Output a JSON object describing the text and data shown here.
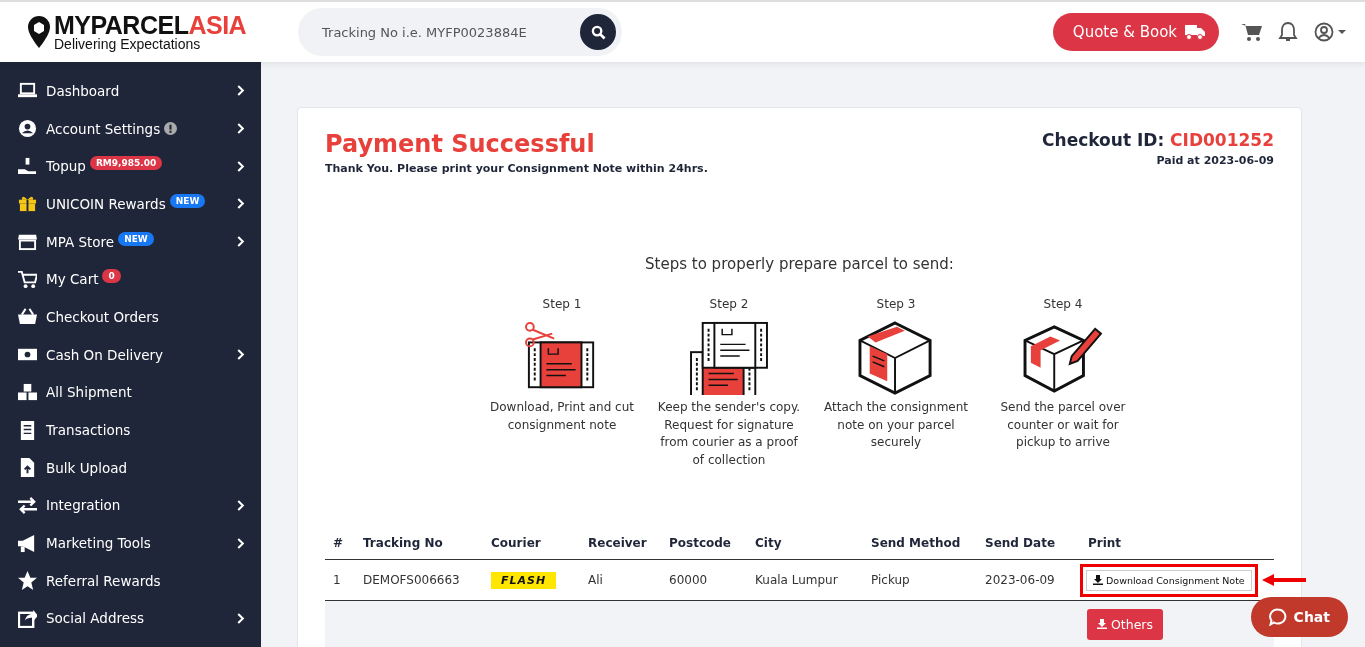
{
  "header": {
    "logo": {
      "main": "MYPARCEL",
      "accent": "ASIA",
      "tagline": "Delivering Expectations"
    },
    "search": {
      "placeholder": "Tracking No i.e. MYFP0023884E"
    },
    "quote_button": "Quote & Book"
  },
  "sidebar": {
    "items": [
      {
        "kind": "laptop",
        "label": "Dashboard",
        "has_submenu": true
      },
      {
        "kind": "user",
        "label": "Account Settings",
        "info": true,
        "has_submenu": true
      },
      {
        "kind": "topup",
        "label": "Topup",
        "badge": {
          "text": "RM9,985.00",
          "kind": "alert"
        },
        "has_submenu": true
      },
      {
        "kind": "gift",
        "label": "UNICOIN Rewards",
        "badge": {
          "text": "NEW",
          "kind": "new"
        },
        "has_submenu": true
      },
      {
        "kind": "store",
        "label": "MPA Store",
        "badge": {
          "text": "NEW",
          "kind": "new"
        },
        "has_submenu": true
      },
      {
        "kind": "cart",
        "label": "My Cart",
        "badge": {
          "text": "0",
          "kind": "count"
        },
        "has_submenu": false
      },
      {
        "kind": "basket",
        "label": "Checkout Orders",
        "has_submenu": false
      },
      {
        "kind": "cash",
        "label": "Cash On Delivery",
        "has_submenu": true
      },
      {
        "kind": "boxes",
        "label": "All Shipment",
        "has_submenu": false
      },
      {
        "kind": "receipt",
        "label": "Transactions",
        "has_submenu": false
      },
      {
        "kind": "upload",
        "label": "Bulk Upload",
        "has_submenu": false
      },
      {
        "kind": "swap",
        "label": "Integration",
        "has_submenu": true
      },
      {
        "kind": "megaphone",
        "label": "Marketing Tools",
        "has_submenu": true
      },
      {
        "kind": "star",
        "label": "Referral Rewards",
        "has_submenu": false
      },
      {
        "kind": "share",
        "label": "Social Address",
        "has_submenu": true
      }
    ]
  },
  "card": {
    "title": "Payment Successful",
    "subtitle": "Thank You. Please print your Consignment Note within 24hrs.",
    "checkout_label": "Checkout ID:",
    "checkout_id": "CID001252",
    "paid_at": "Paid at 2023-06-09",
    "steps_heading": "Steps to properly prepare parcel to send:",
    "steps": [
      {
        "kind": "cut",
        "title": "Step 1",
        "text": "Download, Print and cut consignment note"
      },
      {
        "kind": "copy",
        "title": "Step 2",
        "text": "Keep the sender's copy. Request for signature from courier as a proof of collection"
      },
      {
        "kind": "attach",
        "title": "Step 3",
        "text": "Attach the consignment note on your parcel securely"
      },
      {
        "kind": "send",
        "title": "Step 4",
        "text": "Send the parcel over counter or wait for pickup to arrive"
      }
    ],
    "table": {
      "columns": [
        "#",
        "Tracking No",
        "Courier",
        "Receiver",
        "Postcode",
        "City",
        "Send Method",
        "Send Date",
        "Print"
      ],
      "rows": [
        {
          "index": "1",
          "tracking_no": "DEMOFS006663",
          "courier": "FLASH",
          "receiver": "Ali",
          "postcode": "60000",
          "city": "Kuala Lumpur",
          "send_method": "Pickup",
          "send_date": "2023-06-09",
          "print_button": "Download Consignment Note",
          "highlighted": true
        }
      ],
      "others_button": "Others"
    }
  },
  "chat_button": "Chat"
}
